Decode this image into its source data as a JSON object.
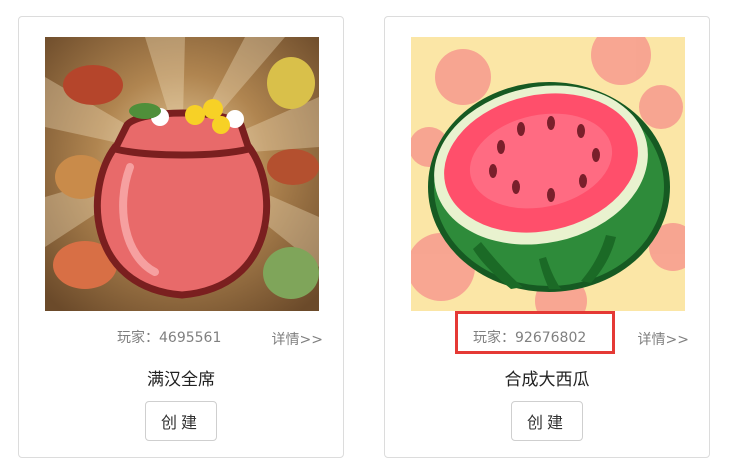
{
  "games": [
    {
      "players_label": "玩家：4695561",
      "details_label": "详情>>",
      "title": "满汉全席",
      "create_label": "创建",
      "image_icon": "treasure-bag-icon"
    },
    {
      "players_label": "玩家：92676802",
      "details_label": "详情>>",
      "title": "合成大西瓜",
      "create_label": "创建",
      "image_icon": "watermelon-icon"
    }
  ],
  "colors": {
    "highlight_border": "#e53935",
    "card_border": "#dcdcdc",
    "muted_text": "#808080"
  }
}
